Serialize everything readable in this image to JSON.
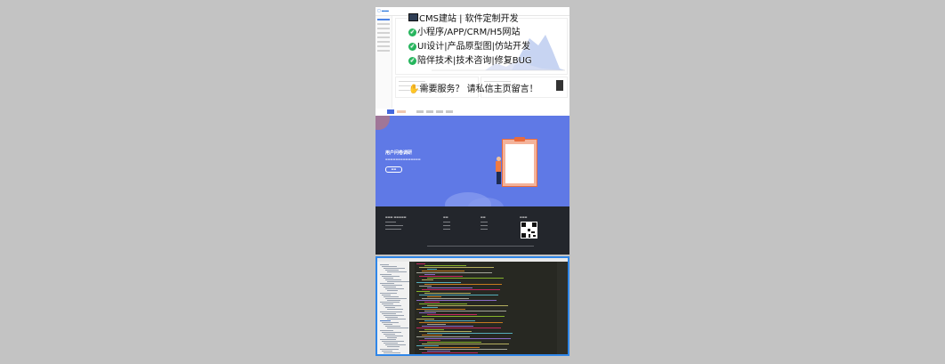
{
  "ad_overlay": {
    "line1": "CMS建站 | 软件定制开发",
    "line2": "小程序/APP/CRM/H5网站",
    "line3": "UI设计|产品原型图|仿站开发",
    "line4": "陪伴技术|技术咨询|修复BUG",
    "cta": "需要服务？ 请私信主页留言！",
    "icon_monitor": "monitor-icon",
    "icon_check": "check-circle-icon",
    "icon_fire": "fire-icon"
  },
  "landing": {
    "hero_title": "用户问卷调研",
    "colors": {
      "hero": "#5f79e6",
      "footer": "#23262c",
      "accent": "#4569de"
    }
  },
  "editor": {
    "highlight_color": "#2f86e8"
  }
}
